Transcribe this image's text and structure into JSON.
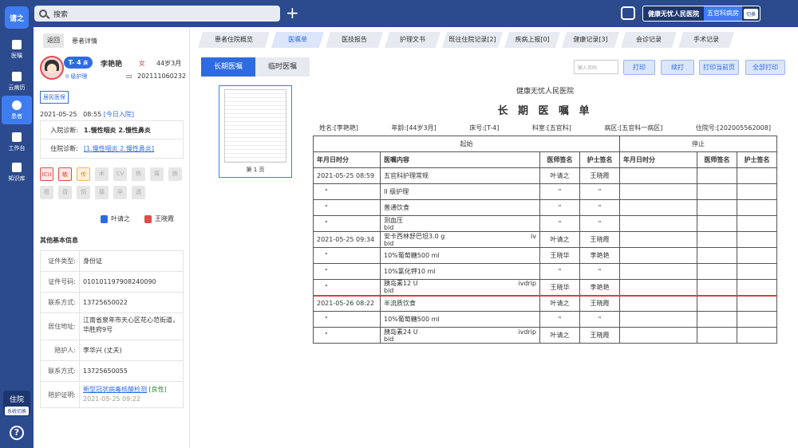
{
  "rail": {
    "logo": "请之",
    "items": [
      "医嘱",
      "云病历",
      "患者",
      "工作台",
      "知识库"
    ],
    "stay": "住院",
    "stay_sub": "系统切换",
    "help": "?"
  },
  "topbar": {
    "search_placeholder": "搜索",
    "hospital": "健康无忧人民医院",
    "ward": "五官科病房",
    "switch": "切换"
  },
  "patient": {
    "back": "返回",
    "title": "患者详情",
    "bed": "T- 4",
    "bed_suffix": "床",
    "name": "李艳艳",
    "sex": "女",
    "age": "44岁3月",
    "nurse_level": "II 级护理",
    "id": "202111060232",
    "insurance": "居民医保",
    "admit_date": "2021-05-25",
    "admit_time": "08:55",
    "admit_link": "[今日入院]",
    "diag": [
      {
        "label": "入院诊断:",
        "value": "1.慢性咽炎    2.慢性鼻炎"
      },
      {
        "label": "住院诊断:",
        "value": "[1.慢性咽炎    2.慢性鼻炎]"
      }
    ],
    "tags": [
      "ICU",
      "敏",
      "传",
      "术",
      "CV",
      "热",
      "痛",
      "跌",
      "梧",
      "昏",
      "饲",
      "感",
      "孕",
      "透"
    ],
    "doctor": "叶请之",
    "nurse": "王晓霞",
    "other_title": "其他基本信息",
    "info": [
      {
        "label": "证件类型:",
        "value": "身份证"
      },
      {
        "label": "证件号码:",
        "value": "010101197908240090"
      },
      {
        "label": "联系方式:",
        "value": "13725650022"
      },
      {
        "label": "居住地址:",
        "value": "江南省泉年市天心区花心范街道，华胜府9号"
      },
      {
        "label": "陪护人:",
        "value": "李华兴 (丈夫)"
      },
      {
        "label": "联系方式:",
        "value": "13725650055"
      }
    ],
    "proof_label": "陪护证明:",
    "proof_link": "新型冠状病毒核酸检测",
    "proof_result": "[良性]",
    "proof_date": "2021-05-25   09:22"
  },
  "tabs": [
    "患者住院概览",
    "医嘱单",
    "医技报告",
    "护理文书",
    "既往住院记录[2]",
    "疾病上报[0]",
    "健康记录[3]",
    "会诊记录",
    "手术记录"
  ],
  "subtabs": [
    "长期医嘱",
    "临时医嘱"
  ],
  "toolbar": {
    "page_placeholder": "输入页码",
    "print": "打印",
    "continue": "续打",
    "print_page": "打印当前页",
    "print_all": "全部打印"
  },
  "thumb_caption": "第 1 页",
  "doc": {
    "hospital": "健康无忧人民医院",
    "title": "长 期 医 嘱 单",
    "meta": [
      "姓名:[李艳艳]",
      "年龄:[44岁3月]",
      "床号:[T-4]",
      "科室:[五官科]",
      "病区:[五官科一病区]",
      "住院号:[202005562008]"
    ],
    "start": "起始",
    "stop": "停止",
    "headers": [
      "年月日时分",
      "医嘱内容",
      "医师签名",
      "护士签名",
      "年月日时分",
      "医师签名",
      "护士签名"
    ],
    "rows": [
      {
        "date": "2021-05-25  08:59",
        "content": "五官科护理常规",
        "route": "",
        "sub": "",
        "doc": "叶请之",
        "nurse": "王晓霞"
      },
      {
        "date": "\"",
        "content": "II 级护理",
        "route": "",
        "sub": "",
        "doc": "\"",
        "nurse": "\""
      },
      {
        "date": "\"",
        "content": "普通饮食",
        "route": "",
        "sub": "",
        "doc": "\"",
        "nurse": "\""
      },
      {
        "date": "\"",
        "content": "测血压",
        "route": "",
        "sub": "bid",
        "doc": "\"",
        "nurse": "\""
      },
      {
        "date": "2021-05-25  09:34",
        "content": "安卡西林舒巴坦3.0 g",
        "route": "iv",
        "sub": "bid",
        "doc": "叶请之",
        "nurse": "王晓霞"
      },
      {
        "date": "\"",
        "content": "10%葡萄糖500 ml",
        "route": "",
        "sub": "",
        "doc": "王晓华",
        "nurse": "李艳艳"
      },
      {
        "date": "\"",
        "content": "10%氯化钾10 ml",
        "route": "",
        "sub": "",
        "doc": "\"",
        "nurse": "\""
      },
      {
        "date": "\"",
        "content": "胰岛素12 U",
        "route": "ivdrip",
        "sub": "bid",
        "doc": "王晓华",
        "nurse": "李艳艳"
      },
      {
        "date": "2021-05-26  08:22",
        "content": "半流质饮食",
        "route": "",
        "sub": "",
        "doc": "叶请之",
        "nurse": "王晓霞"
      },
      {
        "date": "\"",
        "content": "10%葡萄糖500 ml",
        "route": "",
        "sub": "",
        "doc": "\"",
        "nurse": "\""
      },
      {
        "date": "\"",
        "content": "胰岛素24 U",
        "route": "ivdrip",
        "sub": "bid",
        "doc": "叶请之",
        "nurse": "王晓霞"
      }
    ]
  }
}
